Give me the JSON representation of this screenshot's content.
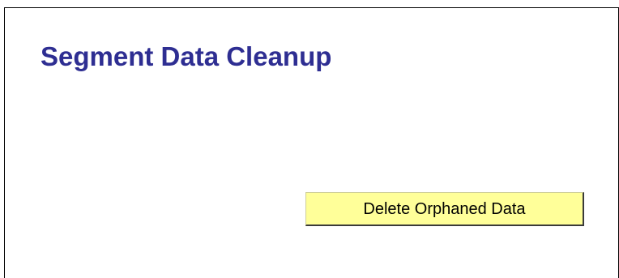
{
  "page": {
    "title": "Segment Data Cleanup"
  },
  "actions": {
    "delete_orphaned_label": "Delete Orphaned Data"
  },
  "colors": {
    "title": "#2e2e92",
    "button_background": "#ffff99",
    "button_shadow": "#3a3a3a",
    "page_background": "#ffffff",
    "frame_border": "#000000"
  }
}
